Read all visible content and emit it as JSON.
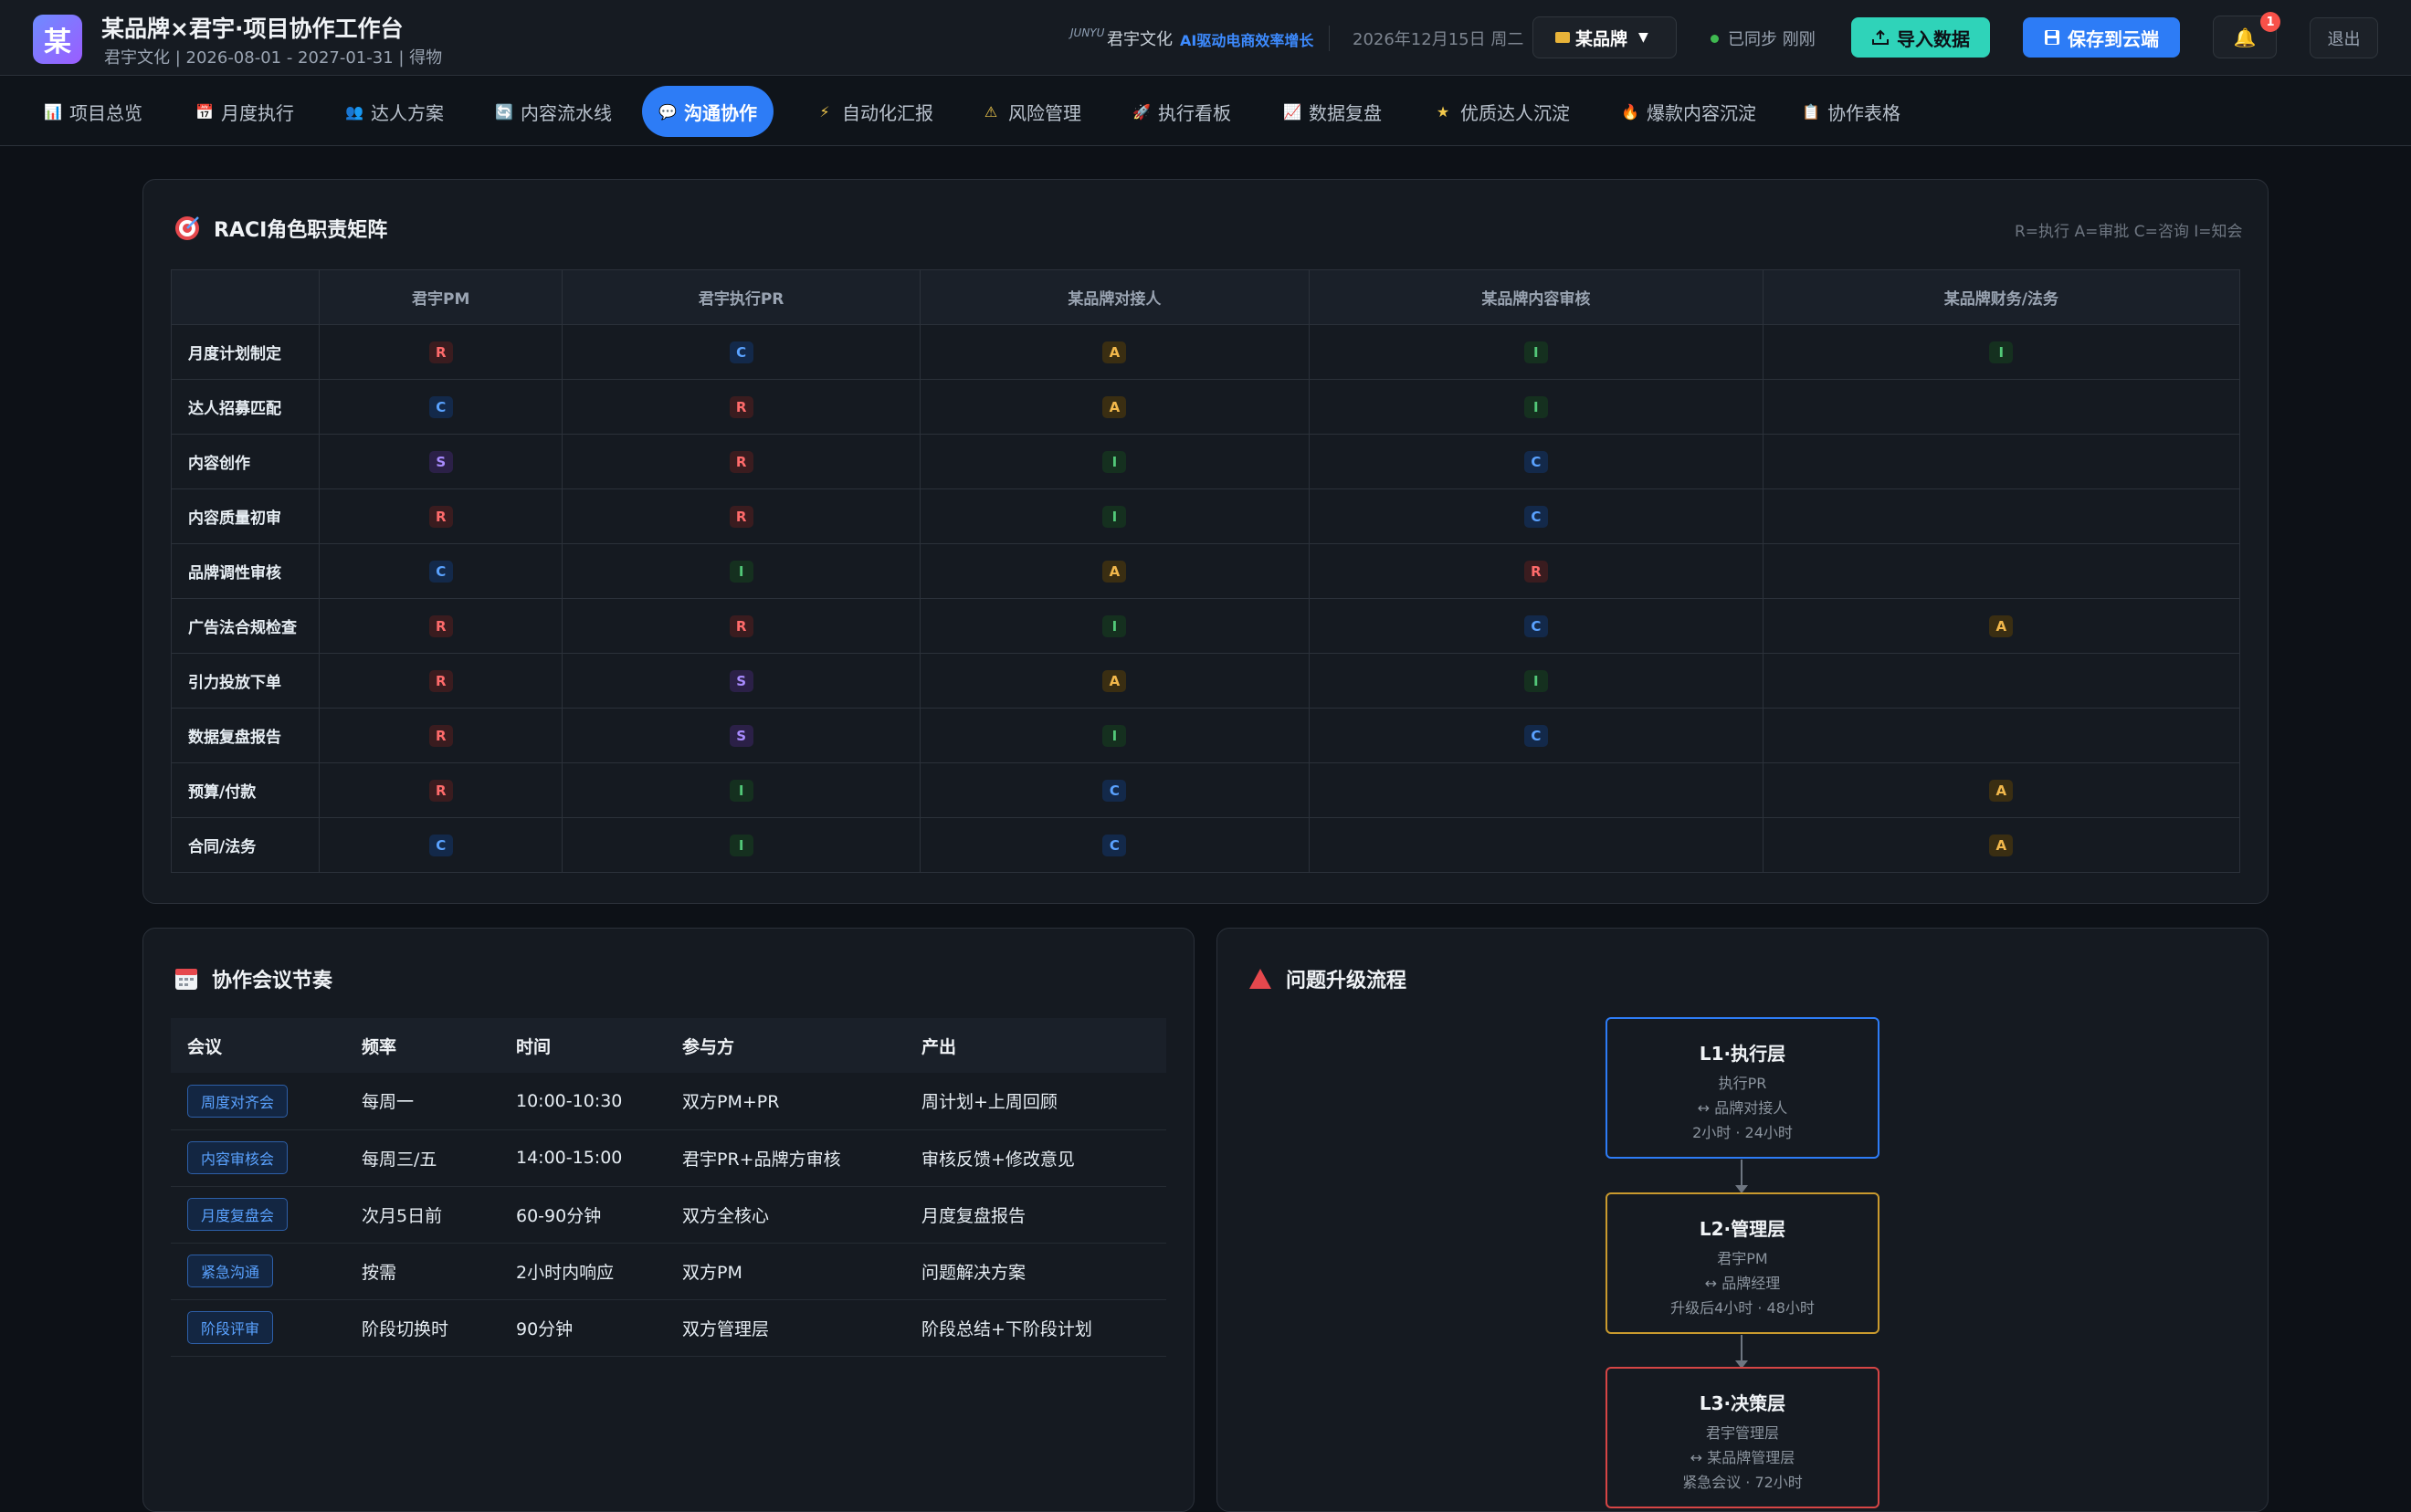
{
  "header": {
    "logo_char": "某",
    "title": "某品牌×君宇·项目协作工作台",
    "subtitle": "君宇文化 | 2026-08-01 - 2027-01-31 | 得物",
    "brand_mark": "JUNYU",
    "brand_name": "君宇文化",
    "brand_tag": "AI驱动电商效率增长",
    "date": "2026年12月15日 周二",
    "brand_select": "某品牌",
    "sync_status": "已同步 刚刚",
    "import_label": "导入数据",
    "save_label": "保存到云端",
    "notification_count": "1",
    "logout_label": "退出"
  },
  "tabs": [
    {
      "icon": "📊",
      "label": "项目总览"
    },
    {
      "icon": "📅",
      "label": "月度执行"
    },
    {
      "icon": "👥",
      "label": "达人方案"
    },
    {
      "icon": "🔄",
      "label": "内容流水线"
    },
    {
      "icon": "💬",
      "label": "沟通协作"
    },
    {
      "icon": "⚡",
      "label": "自动化汇报"
    },
    {
      "icon": "⚠",
      "label": "风险管理"
    },
    {
      "icon": "🚀",
      "label": "执行看板"
    },
    {
      "icon": "📈",
      "label": "数据复盘"
    },
    {
      "icon": "★",
      "label": "优质达人沉淀"
    },
    {
      "icon": "🔥",
      "label": "爆款内容沉淀"
    },
    {
      "icon": "📋",
      "label": "协作表格"
    }
  ],
  "active_tab": 4,
  "raci": {
    "title": "RACI角色职责矩阵",
    "legend": "R=执行 A=审批 C=咨询 I=知会",
    "columns": [
      "君宇PM",
      "君宇执行PR",
      "某品牌对接人",
      "某品牌内容审核",
      "某品牌财务/法务"
    ],
    "rows": [
      {
        "label": "月度计划制定",
        "cells": [
          "R",
          "C",
          "A",
          "I",
          "I"
        ]
      },
      {
        "label": "达人招募匹配",
        "cells": [
          "C",
          "R",
          "A",
          "I",
          ""
        ]
      },
      {
        "label": "内容创作",
        "cells": [
          "S",
          "R",
          "I",
          "C",
          ""
        ]
      },
      {
        "label": "内容质量初审",
        "cells": [
          "R",
          "R",
          "I",
          "C",
          ""
        ]
      },
      {
        "label": "品牌调性审核",
        "cells": [
          "C",
          "I",
          "A",
          "R",
          ""
        ]
      },
      {
        "label": "广告法合规检查",
        "cells": [
          "R",
          "R",
          "I",
          "C",
          "A"
        ]
      },
      {
        "label": "引力投放下单",
        "cells": [
          "R",
          "S",
          "A",
          "I",
          ""
        ]
      },
      {
        "label": "数据复盘报告",
        "cells": [
          "R",
          "S",
          "I",
          "C",
          ""
        ]
      },
      {
        "label": "预算/付款",
        "cells": [
          "R",
          "I",
          "C",
          "",
          "A"
        ]
      },
      {
        "label": "合同/法务",
        "cells": [
          "C",
          "I",
          "C",
          "",
          "A"
        ]
      }
    ]
  },
  "meetings": {
    "title": "协作会议节奏",
    "columns": [
      "会议",
      "频率",
      "时间",
      "参与方",
      "产出"
    ],
    "rows": [
      {
        "name": "周度对齐会",
        "freq": "每周一",
        "time": "10:00-10:30",
        "party": "双方PM+PR",
        "output": "周计划+上周回顾"
      },
      {
        "name": "内容审核会",
        "freq": "每周三/五",
        "time": "14:00-15:00",
        "party": "君宇PR+品牌方审核",
        "output": "审核反馈+修改意见"
      },
      {
        "name": "月度复盘会",
        "freq": "次月5日前",
        "time": "60-90分钟",
        "party": "双方全核心",
        "output": "月度复盘报告"
      },
      {
        "name": "紧急沟通",
        "freq": "按需",
        "time": "2小时内响应",
        "party": "双方PM",
        "output": "问题解决方案"
      },
      {
        "name": "阶段评审",
        "freq": "阶段切换时",
        "time": "90分钟",
        "party": "双方管理层",
        "output": "阶段总结+下阶段计划"
      }
    ]
  },
  "escalation": {
    "title": "问题升级流程",
    "levels": [
      {
        "title": "L1·执行层",
        "line1": "执行PR",
        "line2": "↔ 品牌对接人",
        "line3": "2小时 · 24小时",
        "color": "#2d7cf6"
      },
      {
        "title": "L2·管理层",
        "line1": "君宇PM",
        "line2": "↔ 品牌经理",
        "line3": "升级后4小时 · 48小时",
        "color": "#c99a2e"
      },
      {
        "title": "L3·决策层",
        "line1": "君宇管理层",
        "line2": "↔ 某品牌管理层",
        "line3": "紧急会议 · 72小时",
        "color": "#d64545"
      }
    ]
  }
}
